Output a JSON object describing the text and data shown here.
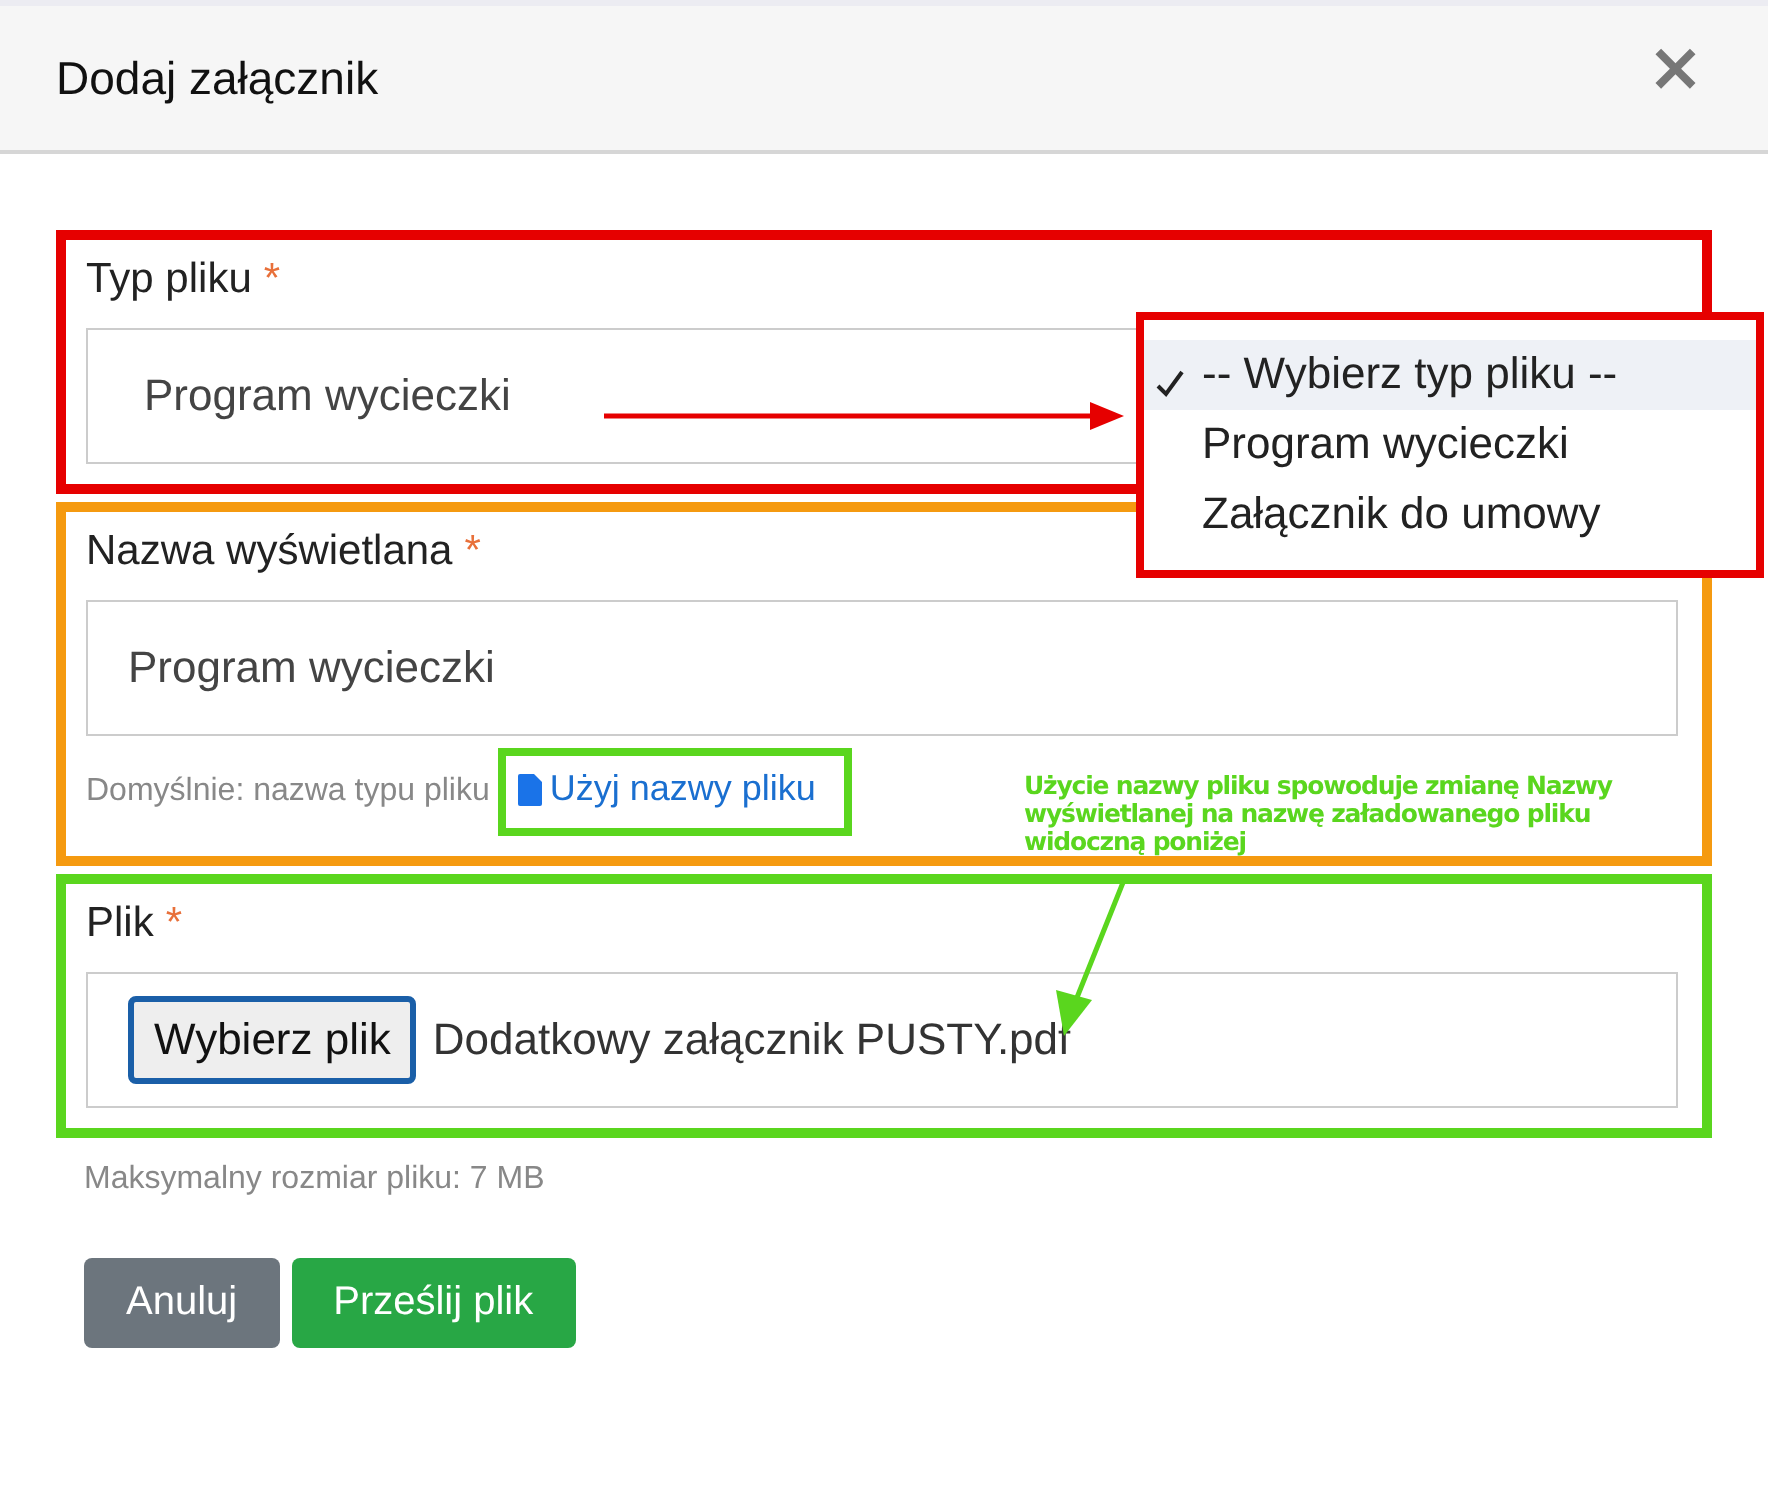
{
  "dialog": {
    "title": "Dodaj załącznik",
    "close": "×"
  },
  "fields": [
    {
      "kind": "select",
      "label": "Typ pliku",
      "required_mark": "*",
      "value": "Program wycieczki",
      "color": "#e60000"
    },
    {
      "kind": "text",
      "label": "Nazwa wyświetlana",
      "required_mark": "*",
      "value": "Program wycieczki",
      "help": "Domyślnie: nazwa typu pliku",
      "link": "Użyj nazwy pliku",
      "color": "#f59a10"
    },
    {
      "kind": "file",
      "label": "Plik",
      "required_mark": "*",
      "button": "Wybierz plik",
      "filename": "Dodatkowy załącznik PUSTY.pdf",
      "color": "#5ad61e"
    }
  ],
  "file_hint": "Maksymalny rozmiar pliku: 7 MB",
  "buttons": [
    {
      "kind": "secondary",
      "label": "Anuluj"
    },
    {
      "kind": "primary",
      "label": "Prześlij plik"
    }
  ],
  "dropdown": {
    "options": [
      {
        "label": "-- Wybierz typ pliku --",
        "selected": true
      },
      {
        "label": "Program wycieczki",
        "selected": false
      },
      {
        "label": "Załącznik do umowy",
        "selected": false
      }
    ]
  },
  "note": "Użycie nazwy pliku spowoduje zmianę Nazwy wyświetlanej na nazwę załadowanego pliku widoczną poniżej"
}
